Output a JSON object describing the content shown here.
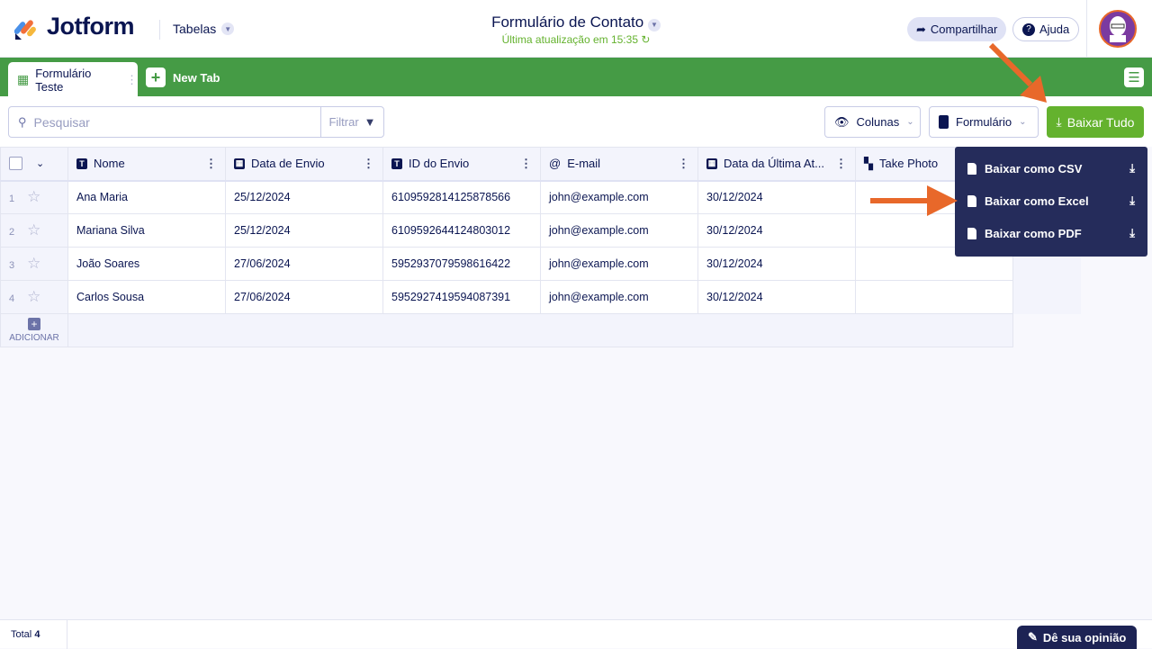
{
  "header": {
    "brand": "Jotform",
    "section": "Tabelas",
    "title": "Formulário de Contato",
    "subtitle": "Última atualização em 15:35",
    "share": "Compartilhar",
    "help": "Ajuda"
  },
  "tabs": {
    "active": "Formulário Teste",
    "new_tab": "New Tab"
  },
  "toolbar": {
    "search_placeholder": "Pesquisar",
    "filter": "Filtrar",
    "columns": "Colunas",
    "form": "Formulário",
    "download_all": "Baixar Tudo"
  },
  "table": {
    "columns": [
      "Nome",
      "Data de Envio",
      "ID do Envio",
      "E-mail",
      "Data da Última At...",
      "Take Photo"
    ],
    "rows": [
      {
        "n": "1",
        "nome": "Ana Maria",
        "data": "25/12/2024",
        "id": "6109592814125878566",
        "email": "john@example.com",
        "atual": "30/12/2024",
        "photo": ""
      },
      {
        "n": "2",
        "nome": "Mariana Silva",
        "data": "25/12/2024",
        "id": "6109592644124803012",
        "email": "john@example.com",
        "atual": "30/12/2024",
        "photo": ""
      },
      {
        "n": "3",
        "nome": "João Soares",
        "data": "27/06/2024",
        "id": "5952937079598616422",
        "email": "john@example.com",
        "atual": "30/12/2024",
        "photo": ""
      },
      {
        "n": "4",
        "nome": "Carlos Sousa",
        "data": "27/06/2024",
        "id": "5952927419594087391",
        "email": "john@example.com",
        "atual": "30/12/2024",
        "photo": ""
      }
    ],
    "add_label": "ADICIONAR"
  },
  "dropdown": {
    "items": [
      "Baixar como CSV",
      "Baixar como Excel",
      "Baixar como PDF"
    ]
  },
  "footer": {
    "total_label": "Total",
    "total": "4",
    "feedback": "Dê sua opinião"
  },
  "colors": {
    "green": "#459b45",
    "accent_green": "#64b22e",
    "navy": "#0a1551",
    "menu_bg": "#252c5b",
    "arrow": "#e8682a"
  }
}
